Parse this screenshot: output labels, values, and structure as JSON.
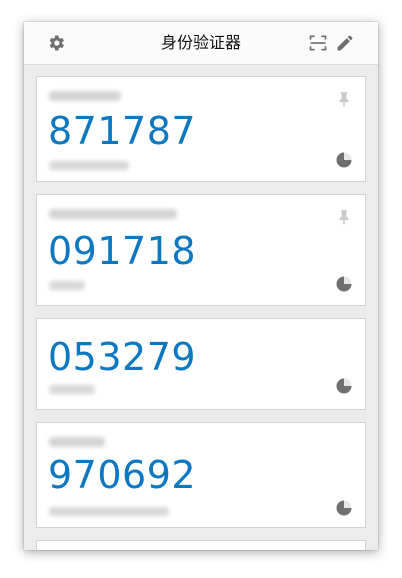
{
  "header": {
    "title": "身份验证器",
    "icons": [
      "gear-icon",
      "scan-icon",
      "pencil-icon"
    ]
  },
  "accounts": [
    {
      "code": "871787",
      "pinned": true,
      "timer_remaining_fraction": 0.75
    },
    {
      "code": "091718",
      "pinned": true,
      "timer_remaining_fraction": 0.75
    },
    {
      "code": "053279",
      "pinned": false,
      "timer_remaining_fraction": 0.75
    },
    {
      "code": "970692",
      "pinned": false,
      "timer_remaining_fraction": 0.75
    }
  ],
  "colors": {
    "code": "#0b78c1",
    "icon": "#7a7a7a",
    "background": "#ececec"
  }
}
